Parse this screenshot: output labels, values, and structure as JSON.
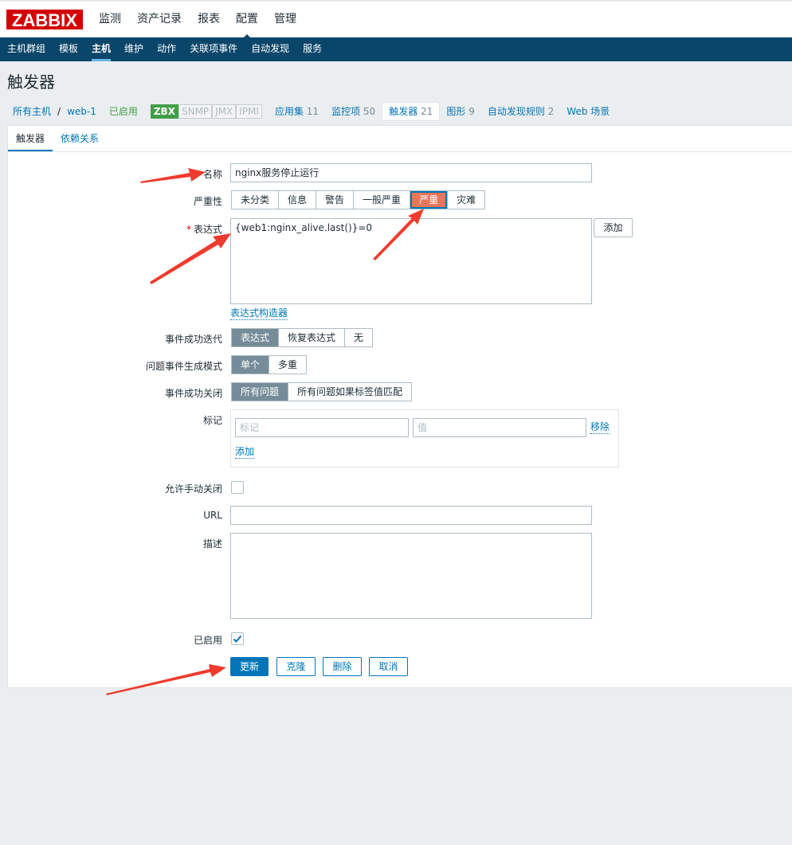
{
  "logo": "ZABBIX",
  "topnav": [
    "监测",
    "资产记录",
    "报表",
    "配置",
    "管理"
  ],
  "subnav": [
    "主机群组",
    "模板",
    "主机",
    "维护",
    "动作",
    "关联项事件",
    "自动发现",
    "服务"
  ],
  "page_title": "触发器",
  "breadcrumb": {
    "all_hosts": "所有主机",
    "sep": "/",
    "host": "web-1",
    "status": "已启用",
    "badges": [
      "ZBX",
      "SNMP",
      "JMX",
      "IPMI"
    ],
    "links": [
      {
        "label": "应用集",
        "count": "11"
      },
      {
        "label": "监控项",
        "count": "50"
      },
      {
        "label": "触发器",
        "count": "21"
      },
      {
        "label": "图形",
        "count": "9"
      },
      {
        "label": "自动发现规则",
        "count": "2"
      },
      {
        "label": "Web 场景",
        "count": ""
      }
    ]
  },
  "tabs": [
    "触发器",
    "依赖关系"
  ],
  "form": {
    "name_label": "名称",
    "name_value": "nginx服务停止运行",
    "severity_label": "严重性",
    "severity_options": [
      "未分类",
      "信息",
      "警告",
      "一般严重",
      "严重",
      "灾难"
    ],
    "severity_selected": "严重",
    "expression_label": "表达式",
    "expression_value": "{web1:nginx_alive.last()}=0",
    "add_button": "添加",
    "expression_builder": "表达式构造器",
    "ok_event_label": "事件成功迭代",
    "ok_event_options": [
      "表达式",
      "恢复表达式",
      "无"
    ],
    "problem_mode_label": "问题事件生成模式",
    "problem_mode_options": [
      "单个",
      "多重"
    ],
    "ok_close_label": "事件成功关闭",
    "ok_close_options": [
      "所有问题",
      "所有问题如果标签值匹配"
    ],
    "tags_label": "标记",
    "tag_placeholder": "标记",
    "value_placeholder": "值",
    "remove_link": "移除",
    "add_link": "添加",
    "manual_close_label": "允许手动关闭",
    "manual_close_checked": false,
    "url_label": "URL",
    "url_value": "",
    "description_label": "描述",
    "description_value": "",
    "enabled_label": "已启用",
    "enabled_checked": true
  },
  "buttons": {
    "update": "更新",
    "clone": "克隆",
    "delete": "删除",
    "cancel": "取消"
  },
  "colors": {
    "header": "#0a466a",
    "severity_high": "#e97659",
    "accent": "#0275b8",
    "arrow": "#ef3b2d"
  }
}
